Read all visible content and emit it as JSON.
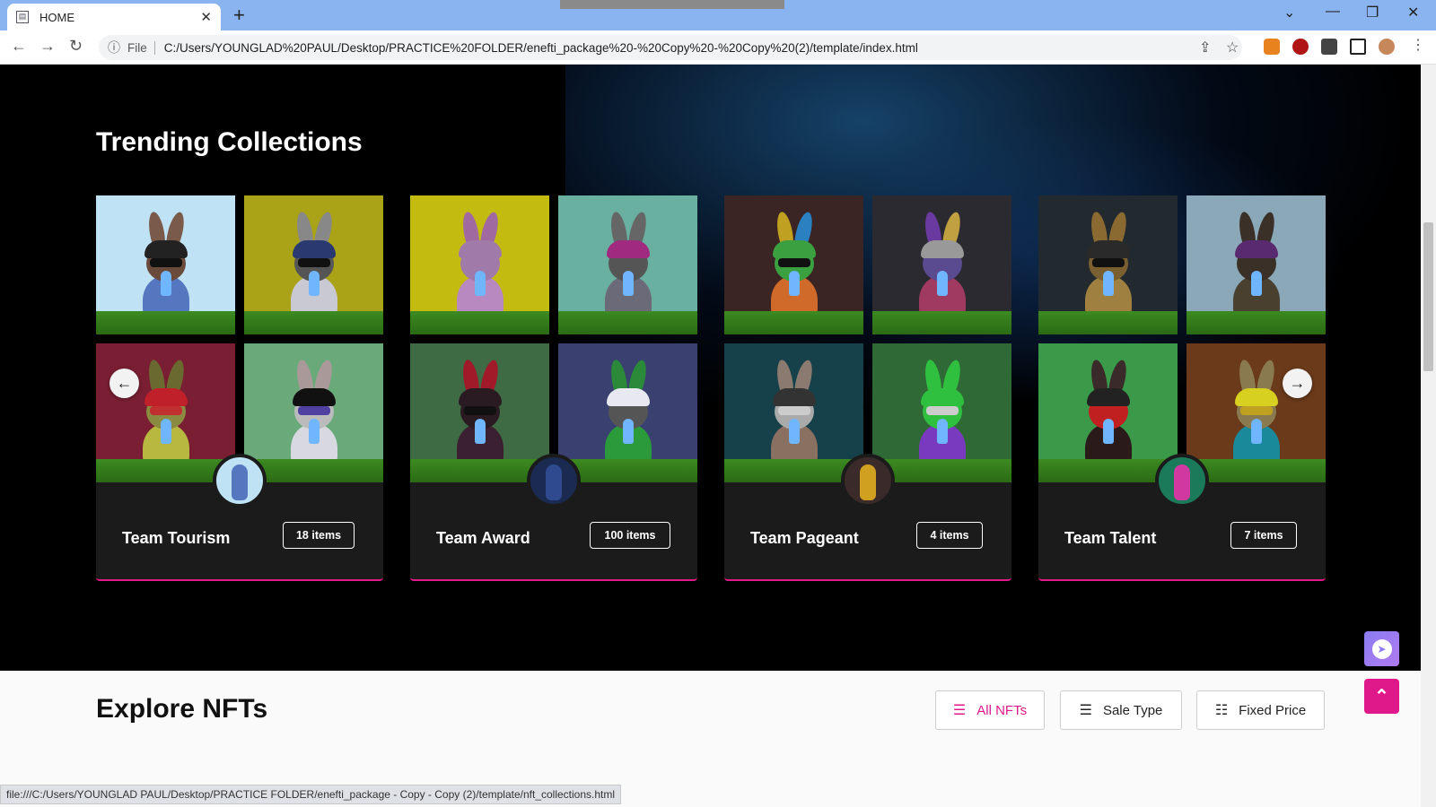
{
  "browser": {
    "tab_title": "HOME",
    "tab_icon": "page-icon",
    "new_tab": "+",
    "scheme_label": "File",
    "url": "C:/Users/YOUNGLAD%20PAUL/Desktop/PRACTICE%20FOLDER/enefti_package%20-%20Copy%20-%20Copy%20(2)/template/index.html",
    "status_url": "file:///C:/Users/YOUNGLAD PAUL/Desktop/PRACTICE FOLDER/enefti_package - Copy - Copy (2)/template/nft_collections.html"
  },
  "trending": {
    "title": "Trending Collections",
    "collections": [
      {
        "name": "Team Tourism",
        "count": "18 items"
      },
      {
        "name": "Team Award",
        "count": "100 items"
      },
      {
        "name": "Team Pageant",
        "count": "4 items"
      },
      {
        "name": "Team Talent",
        "count": "7 items"
      }
    ],
    "prev_icon": "arrow-left-icon",
    "next_icon": "arrow-right-icon"
  },
  "explore": {
    "title": "Explore NFTs",
    "filters": [
      {
        "label": "All NFTs",
        "icon": "menu-icon",
        "color": "#e0198a"
      },
      {
        "label": "Sale Type",
        "icon": "menu-icon",
        "color": "#222222"
      },
      {
        "label": "Fixed Price",
        "icon": "list-filter-icon",
        "color": "#222222"
      }
    ]
  },
  "colors": {
    "accent": "#e0198a",
    "dark_bg": "#000000",
    "card_bg": "#1b1b1b"
  }
}
